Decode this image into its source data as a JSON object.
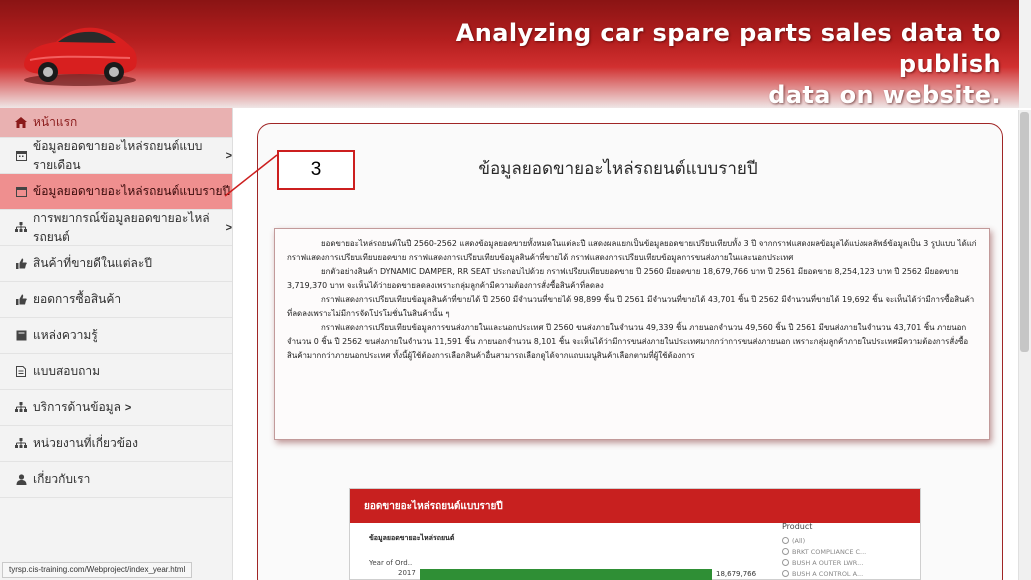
{
  "header": {
    "title_line1": "Analyzing car spare parts sales data to publish",
    "title_line2": "data on website."
  },
  "sidebar": {
    "items": [
      {
        "label": "หน้าแรก",
        "icon": "home-icon",
        "caret": ""
      },
      {
        "label": "ข้อมูลยอดขายอะไหล่รถยนต์แบบรายเดือน",
        "icon": "calendar-icon",
        "caret": ">"
      },
      {
        "label": "ข้อมูลยอดขายอะไหล่รถยนต์แบบรายปี",
        "icon": "calendar-icon",
        "caret": ""
      },
      {
        "label": "การพยากรณ์ข้อมูลยอดขายอะไหล่รถยนต์",
        "icon": "sitemap-icon",
        "caret": ">"
      },
      {
        "label": "สินค้าที่ขายดีในแต่ละปี",
        "icon": "thumbs-up-icon",
        "caret": ""
      },
      {
        "label": "ยอดการซื้อสินค้า",
        "icon": "thumbs-up-icon",
        "caret": ""
      },
      {
        "label": "แหล่งความรู้",
        "icon": "book-icon",
        "caret": ""
      },
      {
        "label": "แบบสอบถาม",
        "icon": "document-icon",
        "caret": ""
      },
      {
        "label": "บริการด้านข้อมูล",
        "icon": "network-icon",
        "caret": ">"
      },
      {
        "label": "หน่วยงานที่เกี่ยวข้อง",
        "icon": "network-icon",
        "caret": ""
      },
      {
        "label": "เกี่ยวกับเรา",
        "icon": "user-icon",
        "caret": ""
      }
    ]
  },
  "status_bar": {
    "url": "tyrsp.cis-training.com/Webproject/index_year.html"
  },
  "main": {
    "page_title": "ข้อมูลยอดขายอะไหล่รถยนต์แบบรายปี",
    "description": [
      "ยอดขายอะไหล่รถยนต์ในปี 2560-2562 แสดงข้อมูลยอดขายทั้งหมดในแต่ละปี แสดงผลแยกเป็นข้อมูลยอดขายเปรียบเทียบทั้ง 3 ปี จากกราฟแสดงผลข้อมูลได้แบ่งผลลัพธ์ข้อมูลเป็น 3 รูปแบบ ได้แก่ กราฟแสดงการเปรียบเทียบยอดขาย กราฟแสดงการเปรียบเทียบข้อมูลสินค้าที่ขายได้ กราฟแสดงการเปรียบเทียบข้อมูลการขนส่งภายในและนอกประเทศ",
      "ยกตัวอย่างสินค้า DYNAMIC DAMPER, RR SEAT ประกอบไปด้วย กราฟเปรียบเทียบยอดขาย ปี 2560 มียอดขาย 18,679,766 บาท ปี 2561 มียอดขาย 8,254,123 บาท ปี 2562 มียอดขาย 3,719,370 บาท จะเห็นได้ว่ายอดขายลดลงเพราะกลุ่มลูกค้ามีความต้องการสั่งซื้อสินค้าที่ลดลง",
      "กราฟแสดงการเปรียบเทียบข้อมูลสินค้าที่ขายได้ ปี 2560 มีจำนวนที่ขายได้ 98,899 ชิ้น ปี 2561 มีจำนวนที่ขายได้ 43,701 ชิ้น ปี 2562 มีจำนวนที่ขายได้ 19,692 ชิ้น จะเห็นได้ว่ามีการซื้อสินค้าที่ลดลงเพราะไม่มีการจัดโปรโมชั่นในสินค้านั้น ๆ",
      "กราฟแสดงการเปรียบเทียบข้อมูลการขนส่งภายในและนอกประเทศ ปี 2560 ขนส่งภายในจำนวน 49,339 ชิ้น ภายนอกจำนวน 49,560 ชิ้น ปี 2561 มีขนส่งภายในจำนวน 43,701 ชิ้น ภายนอกจำนวน 0 ชิ้น ปี 2562 ขนส่งภายในจำนวน 11,591 ชิ้น ภายนอกจำนวน 8,101 ชิ้น จะเห็นได้ว่ามีการขนส่งภายในประเทศมากกว่าการขนส่งภายนอก เพราะกลุ่มลูกค้าภายในประเทศมีความต้องการสั่งซื้อสินค้ามากกว่าภายนอกประเทศ ทั้งนี้ผู้ใช้ต้องการเลือกสินค้าอื่นสามารถเลือกดูได้จากแถบเมนูสินค้าเลือกตามที่ผู้ใช้ต้องการ"
    ],
    "callout": "3"
  },
  "dashboard": {
    "header": "ยอดขายอะไหล่รถยนต์แบบรายปี",
    "subtitle": "ข้อมูลยอดขายอะไหล่รถยนต์",
    "axis_label": "Year of Ord..",
    "year": "2017",
    "value_label": "18,679,766",
    "value_fraction_of_max": 1.0,
    "filter_title": "Product",
    "filter_options": [
      "(All)",
      "BRKT COMPLIANCE C...",
      "BUSH A OUTER LWR...",
      "BUSH A CONTROL A..."
    ]
  },
  "colors": {
    "brand_red": "#c8201f",
    "active_item": "#ef8f8f",
    "bar_green": "#2f8f35"
  }
}
